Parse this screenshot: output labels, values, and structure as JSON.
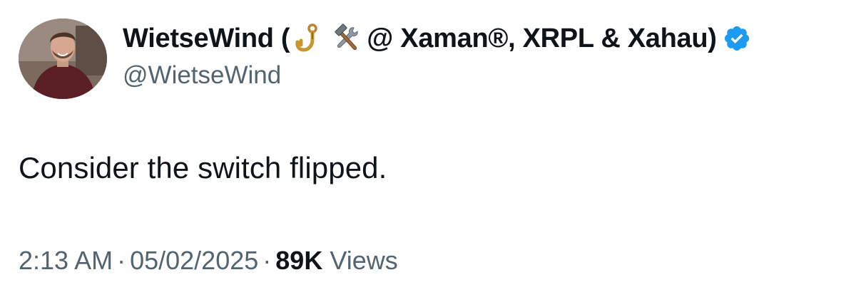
{
  "author": {
    "name_prefix": "WietseWind (",
    "name_suffix": "@ Xaman®, XRPL & Xahau)",
    "emoji_1": "hook-icon",
    "emoji_2": "hammer-and-wrench-icon",
    "verified_badge": "verified-checkmark-icon",
    "verified_color": "#1d9bf0",
    "handle": "@WietseWind"
  },
  "tweet": {
    "text": "Consider the switch flipped."
  },
  "meta": {
    "time": "2:13 AM",
    "separator": "·",
    "date": "05/02/2025",
    "views_count": "89K",
    "views_label": "Views"
  },
  "colors": {
    "text_primary": "#0f1419",
    "text_secondary": "#536471",
    "accent": "#1d9bf0"
  }
}
